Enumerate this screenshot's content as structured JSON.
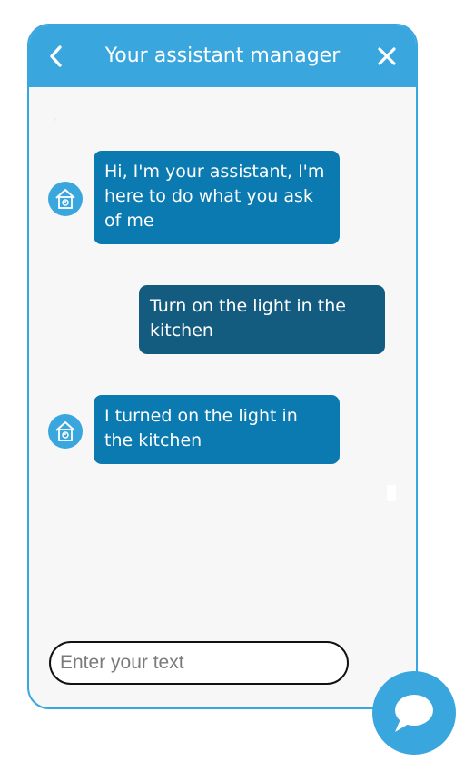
{
  "header": {
    "title": "Your assistant manager",
    "back_icon": "chevron-left-icon",
    "close_icon": "close-icon"
  },
  "messages": [
    {
      "sender": "assistant",
      "text": "Hi, I'm your assistant, I'm here to do what you ask of me"
    },
    {
      "sender": "user",
      "text": "Turn on the light in the kitchen"
    },
    {
      "sender": "assistant",
      "text": "I turned on the light in the kitchen"
    }
  ],
  "assistant_avatar_icon": "smart-home-icon",
  "input": {
    "placeholder": "Enter your text",
    "value": ""
  },
  "launcher_icon": "chat-bubble-icon",
  "colors": {
    "accent": "#3aa6de",
    "assistant_bubble": "#0b7ab0",
    "user_bubble": "#135c80",
    "background": "#f7f7f7"
  }
}
